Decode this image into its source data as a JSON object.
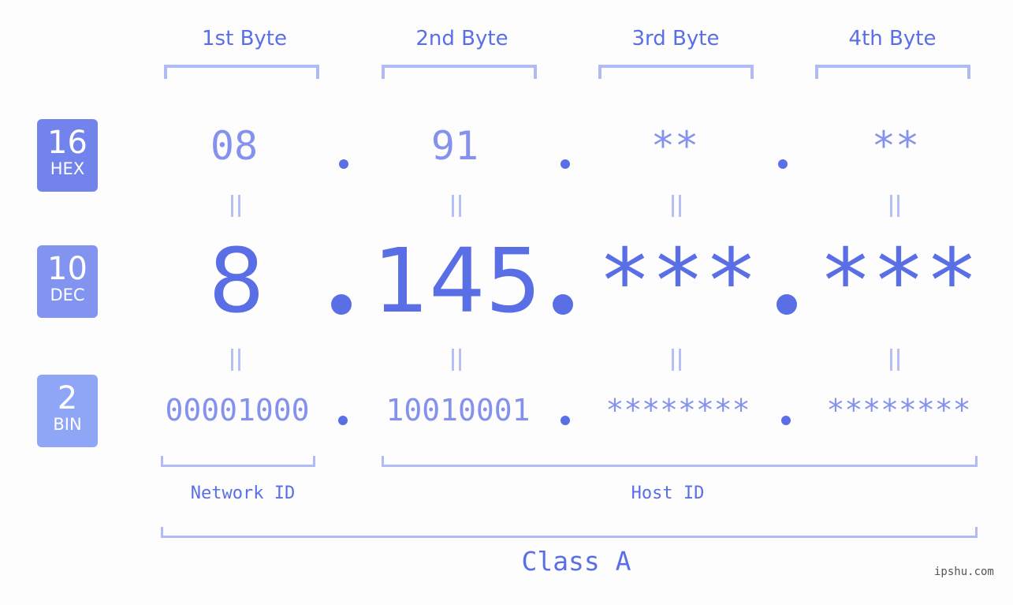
{
  "headers": [
    "1st Byte",
    "2nd Byte",
    "3rd Byte",
    "4th Byte"
  ],
  "badges": [
    {
      "base": "16",
      "name": "HEX",
      "color": "#7383ec"
    },
    {
      "base": "10",
      "name": "DEC",
      "color": "#8294f0"
    },
    {
      "base": "2",
      "name": "BIN",
      "color": "#8fa6f7"
    }
  ],
  "hex": [
    "08",
    "91",
    "**",
    "**"
  ],
  "dec": [
    "8",
    "145",
    "***",
    "***"
  ],
  "bin": [
    "00001000",
    "10010001",
    "********",
    "********"
  ],
  "segments": {
    "network": "Network ID",
    "host": "Host ID",
    "class": "Class A"
  },
  "watermark": "ipshu.com",
  "colors": {
    "primary": "#5a6fe6",
    "secondary": "#8492ee",
    "bracket": "#b0bbf5",
    "background": "#fcfdfc"
  }
}
